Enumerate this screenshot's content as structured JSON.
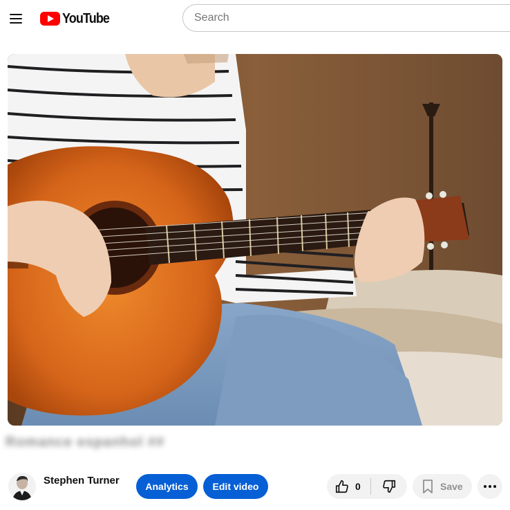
{
  "header": {
    "logo_text": "YouTube",
    "search": {
      "placeholder": "Search",
      "value": ""
    }
  },
  "video": {
    "title": "Romance espanhol ##"
  },
  "channel": {
    "name": "Stephen Turner"
  },
  "actions": {
    "analytics_label": "Analytics",
    "edit_label": "Edit video",
    "like_count": "0",
    "save_label": "Save"
  },
  "colors": {
    "brand_red": "#ff0000",
    "primary_blue": "#065fd4",
    "pill_gray": "#f2f2f2"
  },
  "icons": {
    "menu": "hamburger-menu-icon",
    "logo": "youtube-play-icon",
    "like": "thumbs-up-icon",
    "dislike": "thumbs-down-icon",
    "save": "bookmark-icon",
    "more": "more-horizontal-icon"
  }
}
